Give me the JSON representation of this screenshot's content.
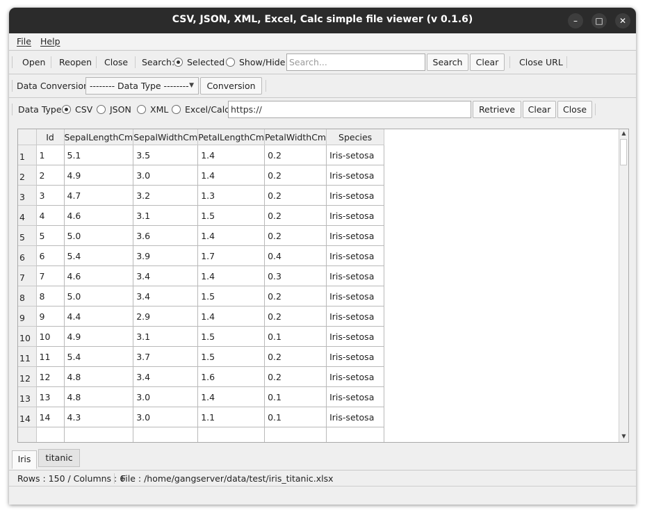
{
  "window": {
    "title": "CSV, JSON, XML, Excel, Calc simple file viewer (v 0.1.6)",
    "minimize_glyph": "–",
    "maximize_glyph": "□",
    "close_glyph": "✕"
  },
  "menu": {
    "file": "File",
    "help": "Help"
  },
  "toolbar1": {
    "open": "Open",
    "reopen": "Reopen",
    "close": "Close",
    "search_label": "Search:",
    "radio_selected": "Selected",
    "radio_showhide": "Show/Hide",
    "search_placeholder": "Search...",
    "search_button": "Search",
    "clear_button": "Clear",
    "close_url": "Close URL"
  },
  "toolbar2": {
    "label": "Data Conversion:",
    "combo_value": "-------- Data Type --------",
    "conversion_button": "Conversion"
  },
  "toolbar3": {
    "label": "Data Type:",
    "csv": "CSV",
    "json": "JSON",
    "xml": "XML",
    "excel": "Excel/Calc",
    "url_value": "https://",
    "retrieve": "Retrieve",
    "clear": "Clear",
    "close": "Close"
  },
  "table": {
    "columns": [
      "Id",
      "SepalLengthCm",
      "SepalWidthCm",
      "PetalLengthCm",
      "PetalWidthCm",
      "Species"
    ],
    "rows": [
      [
        "1",
        "1",
        "5.1",
        "3.5",
        "1.4",
        "0.2",
        "Iris-setosa"
      ],
      [
        "2",
        "2",
        "4.9",
        "3.0",
        "1.4",
        "0.2",
        "Iris-setosa"
      ],
      [
        "3",
        "3",
        "4.7",
        "3.2",
        "1.3",
        "0.2",
        "Iris-setosa"
      ],
      [
        "4",
        "4",
        "4.6",
        "3.1",
        "1.5",
        "0.2",
        "Iris-setosa"
      ],
      [
        "5",
        "5",
        "5.0",
        "3.6",
        "1.4",
        "0.2",
        "Iris-setosa"
      ],
      [
        "6",
        "6",
        "5.4",
        "3.9",
        "1.7",
        "0.4",
        "Iris-setosa"
      ],
      [
        "7",
        "7",
        "4.6",
        "3.4",
        "1.4",
        "0.3",
        "Iris-setosa"
      ],
      [
        "8",
        "8",
        "5.0",
        "3.4",
        "1.5",
        "0.2",
        "Iris-setosa"
      ],
      [
        "9",
        "9",
        "4.4",
        "2.9",
        "1.4",
        "0.2",
        "Iris-setosa"
      ],
      [
        "10",
        "10",
        "4.9",
        "3.1",
        "1.5",
        "0.1",
        "Iris-setosa"
      ],
      [
        "11",
        "11",
        "5.4",
        "3.7",
        "1.5",
        "0.2",
        "Iris-setosa"
      ],
      [
        "12",
        "12",
        "4.8",
        "3.4",
        "1.6",
        "0.2",
        "Iris-setosa"
      ],
      [
        "13",
        "13",
        "4.8",
        "3.0",
        "1.4",
        "0.1",
        "Iris-setosa"
      ],
      [
        "14",
        "14",
        "4.3",
        "3.0",
        "1.1",
        "0.1",
        "Iris-setosa"
      ],
      [
        "",
        "",
        "",
        "",
        "",
        "",
        ""
      ]
    ]
  },
  "tabs": [
    "Iris",
    "titanic"
  ],
  "status": {
    "rows_cols": "Rows : 150 / Columns : 6",
    "file": "File : /home/gangserver/data/test/iris_titanic.xlsx"
  }
}
